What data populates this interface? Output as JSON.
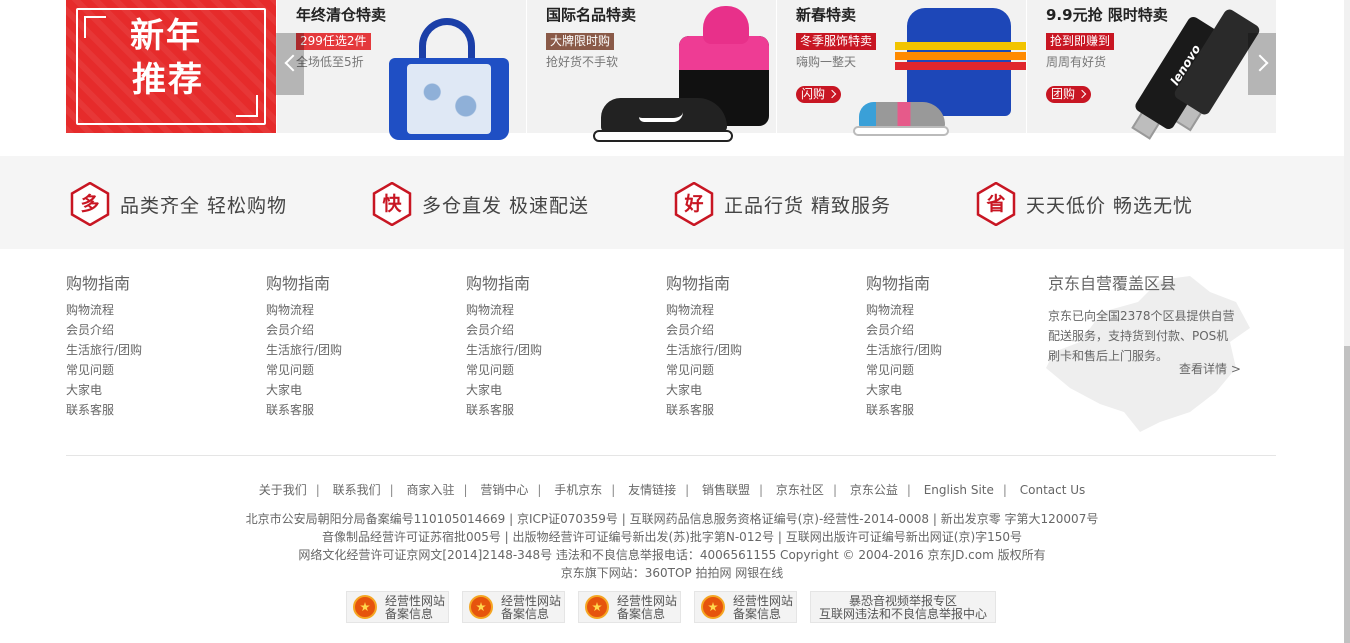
{
  "promo": {
    "newyear": {
      "line1": "新年",
      "line2": "推荐"
    },
    "cards": [
      {
        "title": "年终清仓特卖",
        "tag": "299任选2件",
        "sub": "全场低至5折",
        "button": ""
      },
      {
        "title": "国际名品特卖",
        "tag": "大牌限时购",
        "sub": "抢好货不手软",
        "button": ""
      },
      {
        "title": "新春特卖",
        "tag": "冬季服饰特卖",
        "sub": "嗨购一整天",
        "button": "闪购"
      },
      {
        "title": "9.9元抢 限时特卖",
        "tag": "抢到即赚到",
        "sub": "周周有好货",
        "button": "团购",
        "product_logo": "lenovo"
      }
    ]
  },
  "services": [
    {
      "char": "多",
      "text": "品类齐全  轻松购物"
    },
    {
      "char": "快",
      "text": "多仓直发  极速配送"
    },
    {
      "char": "好",
      "text": "正品行货  精致服务"
    },
    {
      "char": "省",
      "text": "天天低价  畅选无忧"
    }
  ],
  "columns": [
    {
      "title": "购物指南",
      "items": [
        "购物流程",
        "会员介绍",
        "生活旅行/团购",
        "常见问题",
        "大家电",
        "联系客服"
      ]
    },
    {
      "title": "购物指南",
      "items": [
        "购物流程",
        "会员介绍",
        "生活旅行/团购",
        "常见问题",
        "大家电",
        "联系客服"
      ]
    },
    {
      "title": "购物指南",
      "items": [
        "购物流程",
        "会员介绍",
        "生活旅行/团购",
        "常见问题",
        "大家电",
        "联系客服"
      ]
    },
    {
      "title": "购物指南",
      "items": [
        "购物流程",
        "会员介绍",
        "生活旅行/团购",
        "常见问题",
        "大家电",
        "联系客服"
      ]
    },
    {
      "title": "购物指南",
      "items": [
        "购物流程",
        "会员介绍",
        "生活旅行/团购",
        "常见问题",
        "大家电",
        "联系客服"
      ]
    }
  ],
  "coverage": {
    "title": "京东自营覆盖区县",
    "text": "京东已向全国2378个区县提供自营配送服务，支持货到付款、POS机刷卡和售后上门服务。",
    "more": "查看详情 >"
  },
  "footer_links": [
    "关于我们",
    "联系我们",
    "商家入驻",
    "营销中心",
    "手机京东",
    "友情链接",
    "销售联盟",
    "京东社区",
    "京东公益",
    "English Site",
    "Contact Us"
  ],
  "copyright": [
    "北京市公安局朝阳分局备案编号110105014669 | 京ICP证070359号 | 互联网药品信息服务资格证编号(京)-经营性-2014-0008 | 新出发京零 字第大120007号",
    "音像制品经营许可证苏宿批005号 | 出版物经营许可证编号新出发(苏)批字第N-012号 | 互联网出版许可证编号新出网证(京)字150号",
    "网络文化经营许可证京网文[2014]2148-348号 违法和不良信息举报电话：4006561155 Copyright © 2004-2016 京东JD.com 版权所有",
    "京东旗下网站：360TOP 拍拍网 网银在线"
  ],
  "badges": [
    {
      "line1": "经营性网站",
      "line2": "备案信息"
    },
    {
      "line1": "经营性网站",
      "line2": "备案信息"
    },
    {
      "line1": "经营性网站",
      "line2": "备案信息"
    },
    {
      "line1": "经营性网站",
      "line2": "备案信息"
    }
  ],
  "report_badge": {
    "line1": "暴恐音视频举报专区",
    "line2": "互联网违法和不良信息举报中心"
  },
  "colors": {
    "brand_red": "#c81623",
    "service_bg": "#f5f5f5",
    "promo_red": "#e62b2b"
  }
}
